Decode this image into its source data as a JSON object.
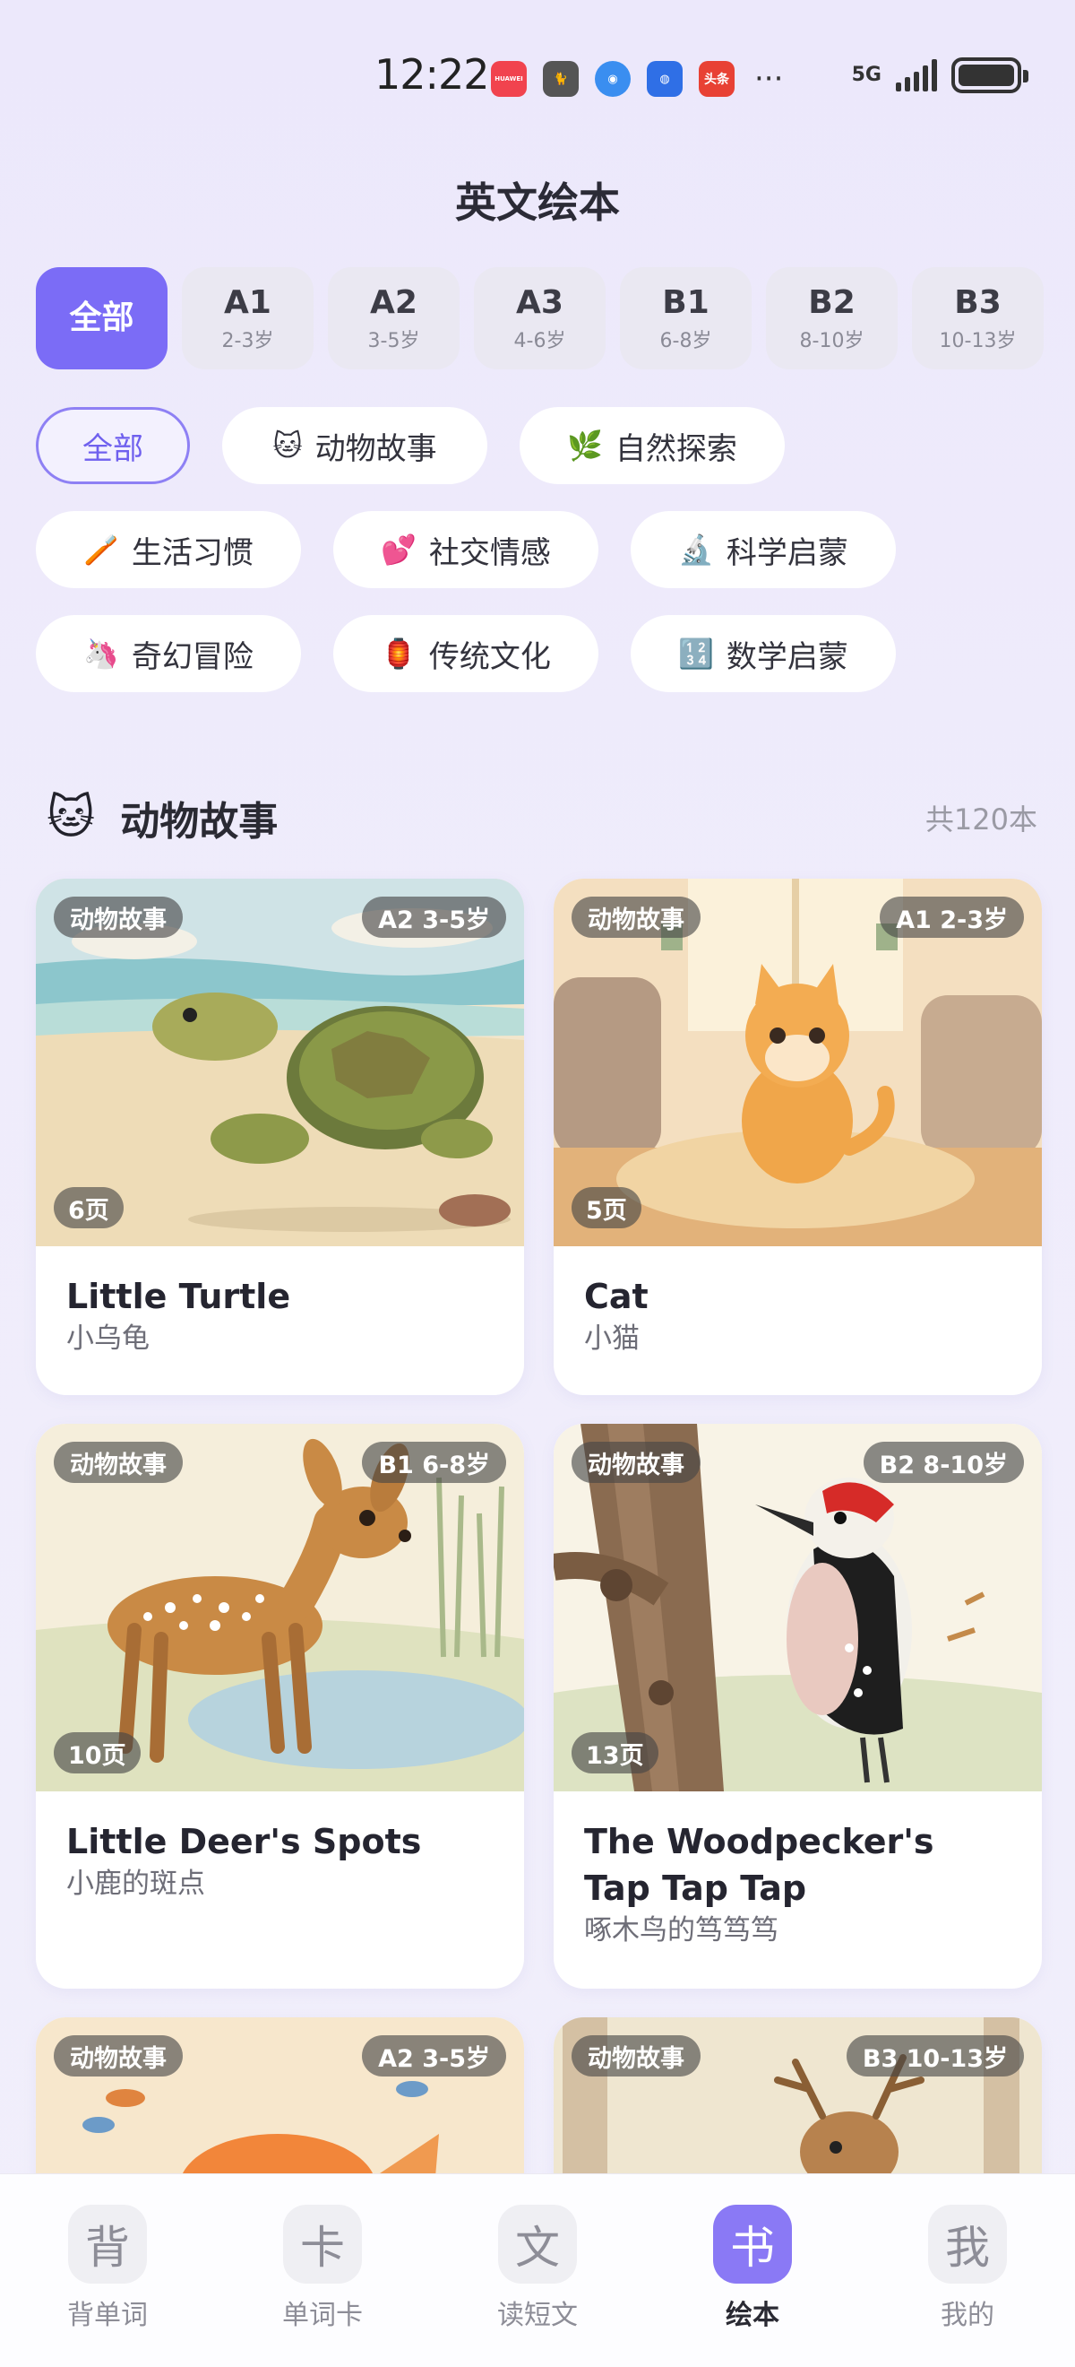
{
  "status": {
    "time": "12:22",
    "network": "5G",
    "more": "···",
    "apps": [
      {
        "icon": "huawei-store-icon",
        "label": "HUAWEI",
        "color": "#f1434e"
      },
      {
        "icon": "cat-app-icon",
        "label": "",
        "color": "#555555"
      },
      {
        "icon": "browser-icon",
        "label": "",
        "color": "#3a8ef0"
      },
      {
        "icon": "shield-app-icon",
        "label": "",
        "color": "#2f6fe6"
      },
      {
        "icon": "toutiao-icon",
        "label": "头条",
        "color": "#e84134"
      }
    ]
  },
  "header": {
    "title": "英文绘本"
  },
  "levels": [
    {
      "label": "全部",
      "age": ""
    },
    {
      "label": "A1",
      "age": "2-3岁"
    },
    {
      "label": "A2",
      "age": "3-5岁"
    },
    {
      "label": "A3",
      "age": "4-6岁"
    },
    {
      "label": "B1",
      "age": "6-8岁"
    },
    {
      "label": "B2",
      "age": "8-10岁"
    },
    {
      "label": "B3",
      "age": "10-13岁"
    }
  ],
  "categories": [
    {
      "label": "全部",
      "emoji": ""
    },
    {
      "label": "动物故事",
      "emoji": "🐱"
    },
    {
      "label": "自然探索",
      "emoji": "🌿"
    },
    {
      "label": "生活习惯",
      "emoji": "🪥"
    },
    {
      "label": "社交情感",
      "emoji": "💕"
    },
    {
      "label": "科学启蒙",
      "emoji": "🔬"
    },
    {
      "label": "奇幻冒险",
      "emoji": "🦄"
    },
    {
      "label": "传统文化",
      "emoji": "🏮"
    },
    {
      "label": "数学启蒙",
      "emoji": "🔢"
    }
  ],
  "section": {
    "emoji": "🐱",
    "title": "动物故事",
    "count": "共120本"
  },
  "books": [
    {
      "category": "动物故事",
      "level": "A2 3-5岁",
      "pages": "6页",
      "title_en": "Little Turtle",
      "title_zh": "小乌龟"
    },
    {
      "category": "动物故事",
      "level": "A1 2-3岁",
      "pages": "5页",
      "title_en": "Cat",
      "title_zh": "小猫"
    },
    {
      "category": "动物故事",
      "level": "B1 6-8岁",
      "pages": "10页",
      "title_en": "Little Deer's Spots",
      "title_zh": "小鹿的斑点"
    },
    {
      "category": "动物故事",
      "level": "B2 8-10岁",
      "pages": "13页",
      "title_en": "The Woodpecker's Tap Tap Tap",
      "title_zh": "啄木鸟的笃笃笃"
    },
    {
      "category": "动物故事",
      "level": "A2 3-5岁",
      "pages": "",
      "title_en": "",
      "title_zh": ""
    },
    {
      "category": "动物故事",
      "level": "B3 10-13岁",
      "pages": "",
      "title_en": "",
      "title_zh": ""
    }
  ],
  "nav": [
    {
      "glyph": "背",
      "label": "背单词"
    },
    {
      "glyph": "卡",
      "label": "单词卡"
    },
    {
      "glyph": "文",
      "label": "读短文"
    },
    {
      "glyph": "书",
      "label": "绘本"
    },
    {
      "glyph": "我",
      "label": "我的"
    }
  ]
}
